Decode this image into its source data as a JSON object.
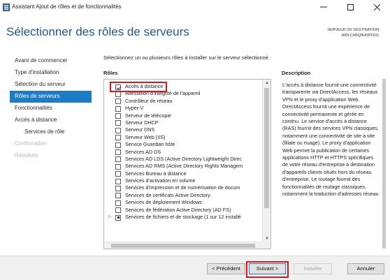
{
  "window": {
    "title": "Assistant Ajout de rôles et de fonctionnalités",
    "icon": "server-manager-icon",
    "controls": [
      "minimize-icon",
      "maximize-icon",
      "close-icon"
    ]
  },
  "header": {
    "title": "Sélectionner des rôles de serveurs",
    "destination_label": "SERVEUR DE DESTINATION",
    "destination_server": "WIN-C6BQ9HSPFDG"
  },
  "nav": {
    "items": [
      {
        "label": "Avant de commencer",
        "state": "normal"
      },
      {
        "label": "Type d'installation",
        "state": "normal"
      },
      {
        "label": "Sélection du serveur",
        "state": "normal"
      },
      {
        "label": "Rôles de serveurs",
        "state": "active"
      },
      {
        "label": "Fonctionnalités",
        "state": "normal"
      },
      {
        "label": "Accès à distance",
        "state": "normal"
      },
      {
        "label": "Services de rôle",
        "state": "sub"
      },
      {
        "label": "Confirmation",
        "state": "disabled"
      },
      {
        "label": "Résultats",
        "state": "disabled"
      }
    ]
  },
  "main": {
    "intro": "Sélectionnez un ou plusieurs rôles à installer sur le serveur sélectionné.",
    "roles_title": "Rôles",
    "description_title": "Description",
    "roles": [
      {
        "label": "Accès à distance",
        "checked": true
      },
      {
        "label": "Attestation d'intégrité de l'appareil",
        "checked": false
      },
      {
        "label": "Contrôleur de réseau",
        "checked": false
      },
      {
        "label": "Hyper-V",
        "checked": false
      },
      {
        "label": "Serveur de télécopie",
        "checked": false
      },
      {
        "label": "Serveur DHCP",
        "checked": false
      },
      {
        "label": "Serveur DNS",
        "checked": false
      },
      {
        "label": "Serveur Web (IIS)",
        "checked": false
      },
      {
        "label": "Service Guardian hôte",
        "checked": false
      },
      {
        "label": "Services AD DS",
        "checked": false
      },
      {
        "label": "Services AD LDS (Active Directory Lightweight Direc",
        "checked": false
      },
      {
        "label": "Services AD RMS (Active Directory Rights Managem",
        "checked": false
      },
      {
        "label": "Services Bureau à distance",
        "checked": false
      },
      {
        "label": "Services d'activation en volume",
        "checked": false
      },
      {
        "label": "Services d'impression et de numérisation de docum",
        "checked": false
      },
      {
        "label": "Services de certificats Active Directory",
        "checked": false
      },
      {
        "label": "Services de déploiement Windows",
        "checked": false
      },
      {
        "label": "Services de fédération Active Directory (AD FS)",
        "checked": false
      },
      {
        "label": "Services de fichiers et de stockage (1 sur 12 installé",
        "checked": "partial",
        "expandable": true
      }
    ],
    "description": "L'accès à distance fournit une connectivité transparente via DirectAccess, les réseaux VPN et le proxy d'application Web. DirectAccess fournit une expérience de connectivité permanente et gérée en continu. Le service d'accès à distance (RAS) fournit des services VPN classiques, notamment une connectivité de site à site (filiale ou nuage). Le proxy d'application Web permet la publication de certaines applications HTTP et HTTPS spécifiques de votre réseau d'entreprise à destination d'appareils clients situés hors du réseau d'entreprise. Le routage fournit des fonctionnalités de routage classiques, notamment la traduction d'adresses réseau"
  },
  "footer": {
    "prev": "< Précédent",
    "next": "Suivant >",
    "install": "Installer",
    "cancel": "Annuler"
  },
  "colors": {
    "accent": "#1e7bc6",
    "title": "#1f5a8c",
    "highlight": "#e3151a"
  }
}
